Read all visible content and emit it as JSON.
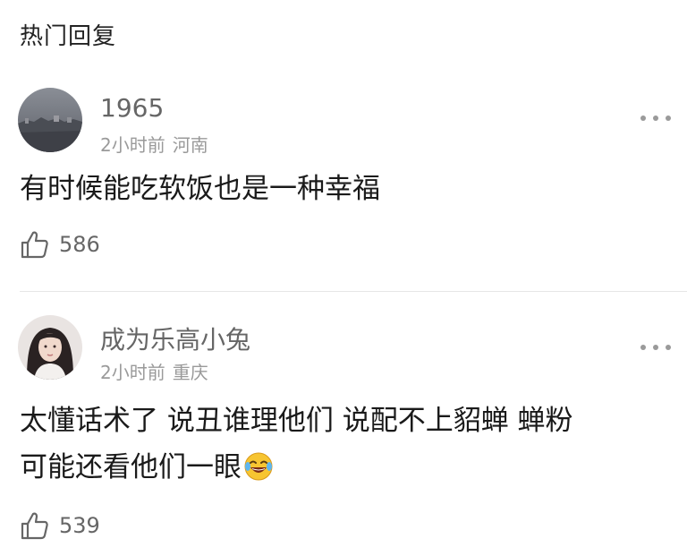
{
  "header": {
    "title": "热门回复"
  },
  "comments": [
    {
      "username": "1965",
      "time": "2小时前",
      "location": "河南",
      "text": "有时候能吃软饭也是一种幸福",
      "likes": "586",
      "avatar": "landscape-avatar"
    },
    {
      "username": "成为乐高小兔",
      "time": "2小时前",
      "location": "重庆",
      "text_line1": "太懂话术了 说丑谁理他们 说配不上貂蝉 蝉粉",
      "text_line2": "可能还看他们一眼",
      "emoji": "laughing-tears-emoji",
      "likes": "539",
      "avatar": "girl-portrait-avatar"
    }
  ],
  "colors": {
    "text": "#1a1a1a",
    "username": "#666666",
    "meta": "#9a9a9a",
    "divider": "#e6e6e6"
  }
}
